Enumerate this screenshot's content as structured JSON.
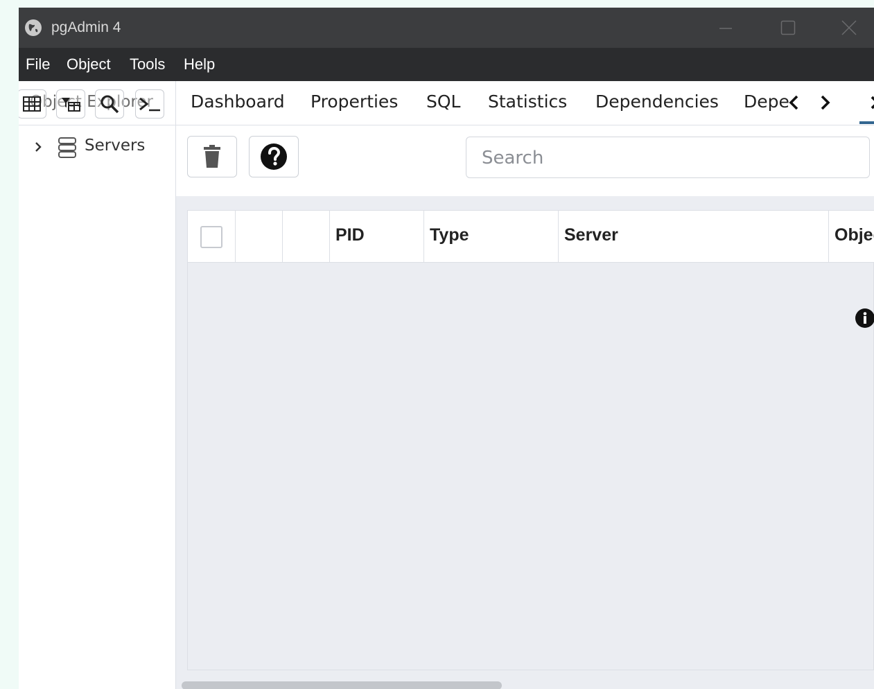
{
  "app": {
    "title": "pgAdmin 4"
  },
  "menu": {
    "items": [
      "File",
      "Object",
      "Tools",
      "Help"
    ]
  },
  "explorer": {
    "title": "Object Explorer",
    "tree": [
      {
        "label": "Servers"
      }
    ]
  },
  "tabs": {
    "items": [
      "Dashboard",
      "Properties",
      "SQL",
      "Statistics",
      "Dependencies",
      "Dependents"
    ]
  },
  "toolbar": {
    "search_placeholder": "Search"
  },
  "grid": {
    "columns": [
      "PID",
      "Type",
      "Server",
      "Object"
    ]
  },
  "colors": {
    "titlebar": "#3c3d3f",
    "menubar": "#2b2c2e",
    "panel_bg": "#ebedf2",
    "accent": "#326690"
  }
}
